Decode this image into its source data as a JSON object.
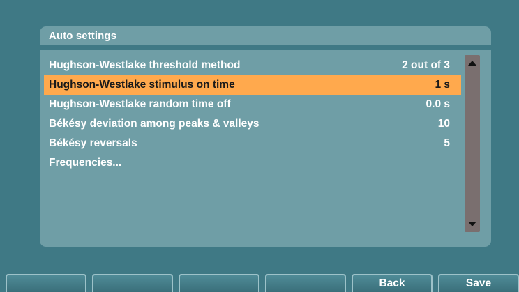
{
  "panel": {
    "title": "Auto settings",
    "rows": [
      {
        "label": "Hughson-Westlake threshold method",
        "value": "2 out of 3"
      },
      {
        "label": "Hughson-Westlake stimulus on time",
        "value": "1 s"
      },
      {
        "label": "Hughson-Westlake random time off",
        "value": "0.0 s"
      },
      {
        "label": "Békésy deviation among peaks & valleys",
        "value": "10"
      },
      {
        "label": "Békésy reversals",
        "value": "5"
      },
      {
        "label": "Frequencies...",
        "value": ""
      }
    ],
    "selected_index": 1
  },
  "scrollbar": {
    "up_icon": "triangle-up-icon",
    "down_icon": "triangle-down-icon"
  },
  "softkeys": [
    "",
    "",
    "",
    "",
    "Back",
    "Save"
  ],
  "colors": {
    "background": "#3f7985",
    "panel": "#6f9ea6",
    "highlight": "#ffa94d",
    "scrollbar": "#7a6f6f"
  }
}
